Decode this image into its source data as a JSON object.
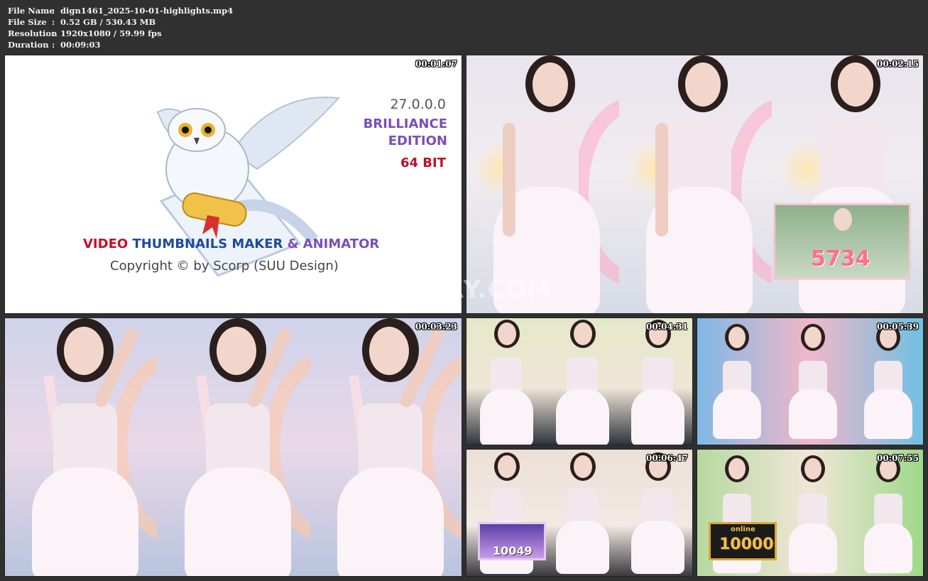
{
  "info": {
    "rows": [
      {
        "key": "File Name",
        "sep": ":",
        "value": "dign1461_2025-10-01-highlights.mp4"
      },
      {
        "key": "File Size",
        "sep": ":",
        "value": "0.52 GB / 530.43 MB"
      },
      {
        "key": "Resolution",
        "sep": ":",
        "value": "1920x1080 / 59.99 fps"
      },
      {
        "key": "Duration",
        "sep": ":",
        "value": "00:09:03"
      }
    ]
  },
  "splash": {
    "version": "27.0.0.0",
    "edition_line1": "BRILLIANCE",
    "edition_line2": "EDITION",
    "bits": "64 BIT",
    "title_video": "VIDEO",
    "title_thumbnails": "THUMBNAILS MAKER",
    "title_amp": "&",
    "title_animator": "ANIMATOR",
    "copyright": "Copyright © by Scorp (SUU Design)",
    "timestamp": "00:01:07",
    "colors": {
      "purple": "#7a4fb8",
      "red": "#c0102a",
      "blue": "#1d4aa0"
    }
  },
  "thumbnails": [
    {
      "timestamp": "00:02:15",
      "badge_number": "5734"
    },
    {
      "timestamp": "00:03:23"
    },
    {
      "timestamp": "00:04:31"
    },
    {
      "timestamp": "00:05:39"
    },
    {
      "timestamp": "00:06:47",
      "badge_number": "10049"
    },
    {
      "timestamp": "00:07:55",
      "badge_word": "online",
      "badge_number": "10000"
    }
  ],
  "watermark": "LEAKGALLERY.COM"
}
